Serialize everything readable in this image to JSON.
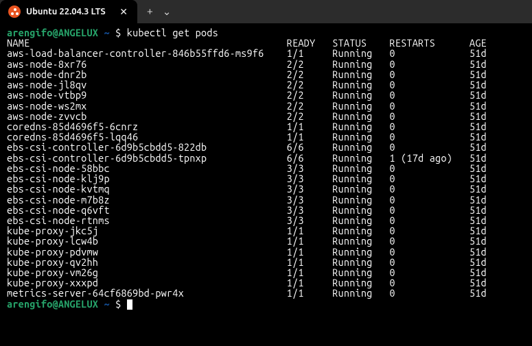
{
  "tab": {
    "title": "Ubuntu 22.04.3 LTS",
    "close": "✕",
    "new_tab": "+",
    "menu": "⌄"
  },
  "prompt": {
    "user_host": "arengifo@ANGELUX",
    "path": "~",
    "dollar": "$"
  },
  "command": "kubectl get pods",
  "headers": {
    "name": "NAME",
    "ready": "READY",
    "status": "STATUS",
    "restarts": "RESTARTS",
    "age": "AGE"
  },
  "pods": [
    {
      "name": "aws-load-balancer-controller-846b55ffd6-ms9f6",
      "ready": "1/1",
      "status": "Running",
      "restarts": "0",
      "age": "51d"
    },
    {
      "name": "aws-node-8xr76",
      "ready": "2/2",
      "status": "Running",
      "restarts": "0",
      "age": "51d"
    },
    {
      "name": "aws-node-dnr2b",
      "ready": "2/2",
      "status": "Running",
      "restarts": "0",
      "age": "51d"
    },
    {
      "name": "aws-node-jl8qv",
      "ready": "2/2",
      "status": "Running",
      "restarts": "0",
      "age": "51d"
    },
    {
      "name": "aws-node-vtbp9",
      "ready": "2/2",
      "status": "Running",
      "restarts": "0",
      "age": "51d"
    },
    {
      "name": "aws-node-ws2mx",
      "ready": "2/2",
      "status": "Running",
      "restarts": "0",
      "age": "51d"
    },
    {
      "name": "aws-node-zvvcb",
      "ready": "2/2",
      "status": "Running",
      "restarts": "0",
      "age": "51d"
    },
    {
      "name": "coredns-85d4696f5-6cnrz",
      "ready": "1/1",
      "status": "Running",
      "restarts": "0",
      "age": "51d"
    },
    {
      "name": "coredns-85d4696f5-lqq46",
      "ready": "1/1",
      "status": "Running",
      "restarts": "0",
      "age": "51d"
    },
    {
      "name": "ebs-csi-controller-6d9b5cbdd5-822db",
      "ready": "6/6",
      "status": "Running",
      "restarts": "0",
      "age": "51d"
    },
    {
      "name": "ebs-csi-controller-6d9b5cbdd5-tpnxp",
      "ready": "6/6",
      "status": "Running",
      "restarts": "1 (17d ago)",
      "age": "51d"
    },
    {
      "name": "ebs-csi-node-58bbc",
      "ready": "3/3",
      "status": "Running",
      "restarts": "0",
      "age": "51d"
    },
    {
      "name": "ebs-csi-node-klj9p",
      "ready": "3/3",
      "status": "Running",
      "restarts": "0",
      "age": "51d"
    },
    {
      "name": "ebs-csi-node-kvtmq",
      "ready": "3/3",
      "status": "Running",
      "restarts": "0",
      "age": "51d"
    },
    {
      "name": "ebs-csi-node-m7b8z",
      "ready": "3/3",
      "status": "Running",
      "restarts": "0",
      "age": "51d"
    },
    {
      "name": "ebs-csi-node-q6vft",
      "ready": "3/3",
      "status": "Running",
      "restarts": "0",
      "age": "51d"
    },
    {
      "name": "ebs-csi-node-rtnms",
      "ready": "3/3",
      "status": "Running",
      "restarts": "0",
      "age": "51d"
    },
    {
      "name": "kube-proxy-jkc5j",
      "ready": "1/1",
      "status": "Running",
      "restarts": "0",
      "age": "51d"
    },
    {
      "name": "kube-proxy-lcw4b",
      "ready": "1/1",
      "status": "Running",
      "restarts": "0",
      "age": "51d"
    },
    {
      "name": "kube-proxy-pdvmw",
      "ready": "1/1",
      "status": "Running",
      "restarts": "0",
      "age": "51d"
    },
    {
      "name": "kube-proxy-qv2hh",
      "ready": "1/1",
      "status": "Running",
      "restarts": "0",
      "age": "51d"
    },
    {
      "name": "kube-proxy-vm26g",
      "ready": "1/1",
      "status": "Running",
      "restarts": "0",
      "age": "51d"
    },
    {
      "name": "kube-proxy-xxxpd",
      "ready": "1/1",
      "status": "Running",
      "restarts": "0",
      "age": "51d"
    },
    {
      "name": "metrics-server-64cf6869bd-pwr4x",
      "ready": "1/1",
      "status": "Running",
      "restarts": "0",
      "age": "51d"
    }
  ],
  "columns": {
    "name_w": 49,
    "ready_w": 8,
    "status_w": 10,
    "restarts_w": 14
  }
}
